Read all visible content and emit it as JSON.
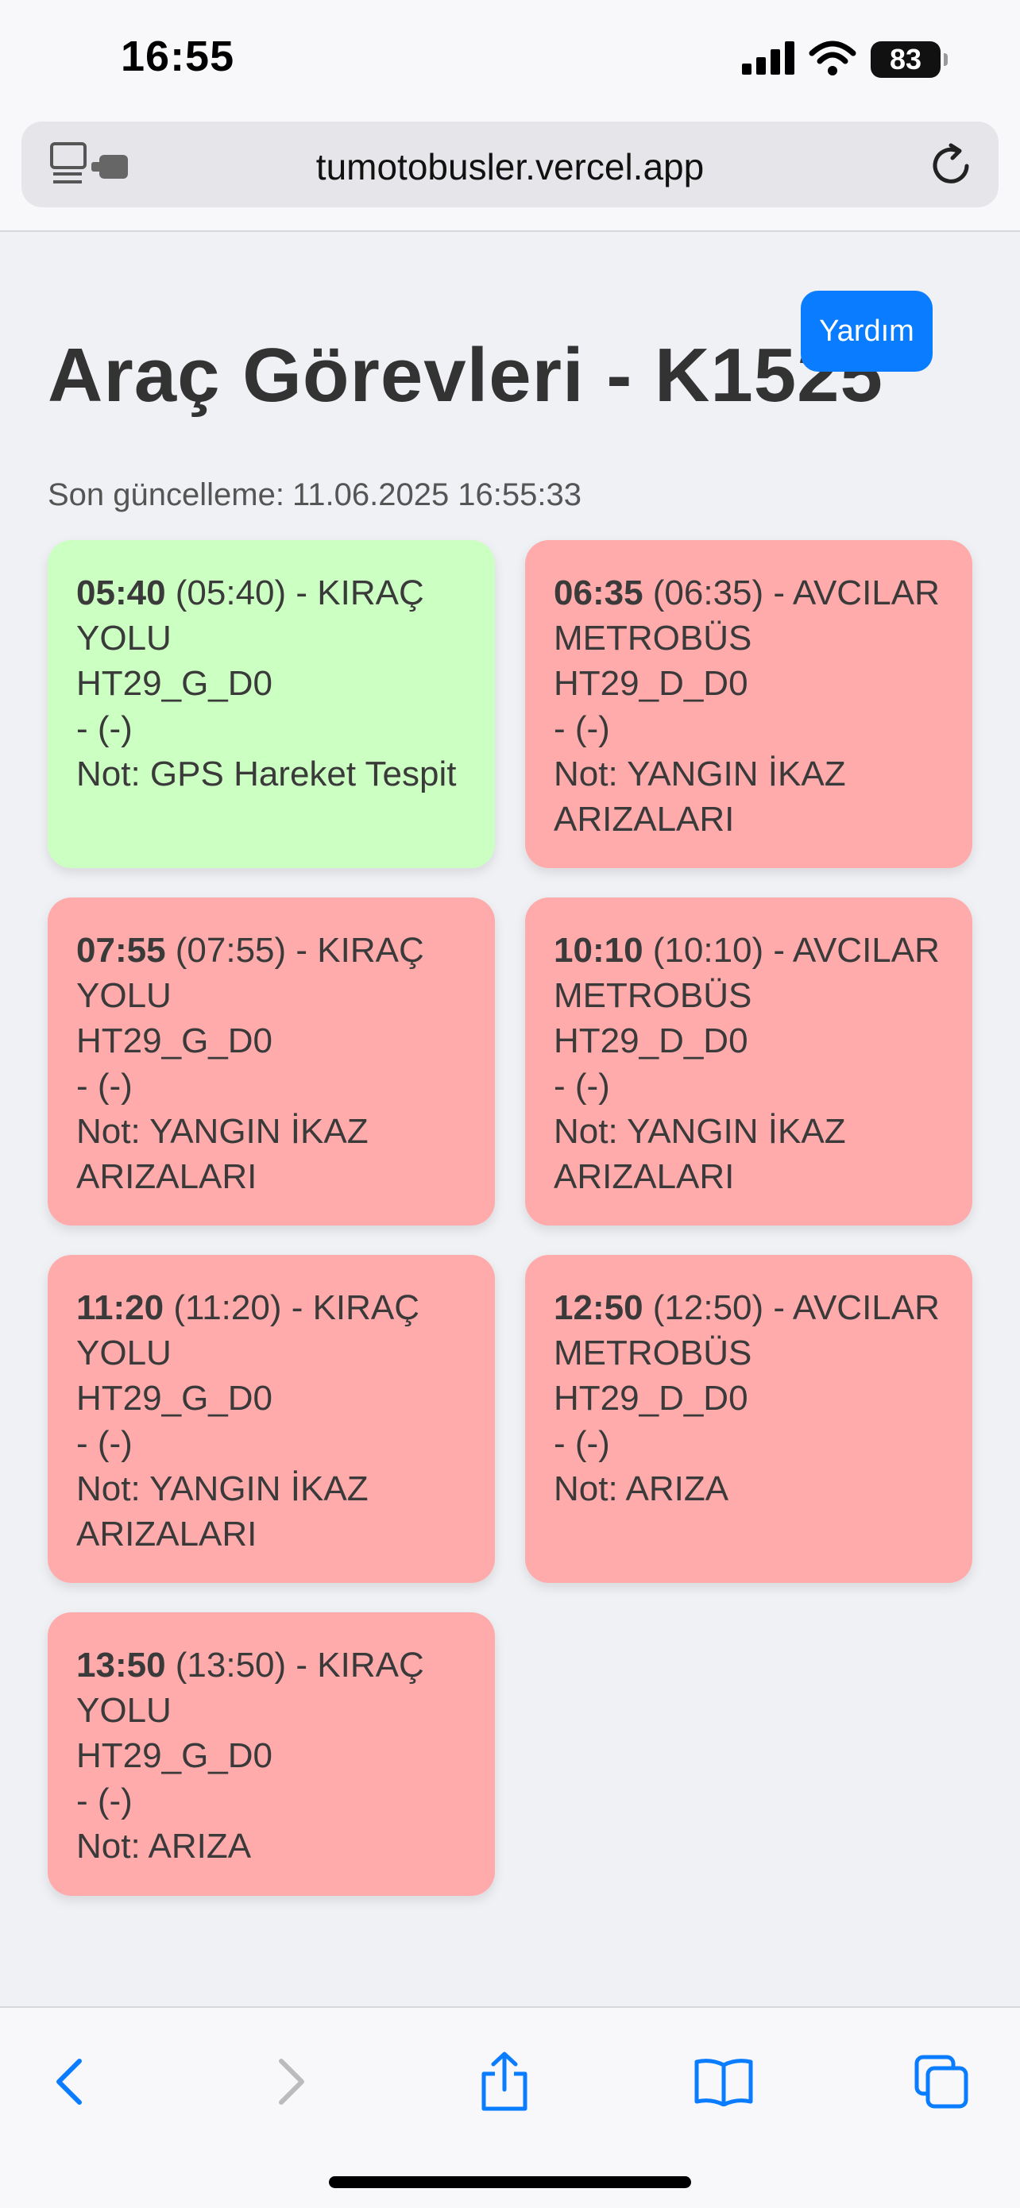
{
  "status_bar": {
    "time": "16:55",
    "battery": "83"
  },
  "browser": {
    "url": "tumotobusler.vercel.app"
  },
  "header": {
    "help_label": "Yardım",
    "title": "Araç Görevleri - K1525",
    "updated_label": "Son güncelleme:",
    "updated_value": "11.06.2025 16:55:33"
  },
  "cards": [
    {
      "time": "05:40",
      "rest_1": " (05:40) - KIRAÇ YOLU",
      "code": "HT29_G_D0",
      "extra": "- (-)",
      "note": "Not: GPS Hareket Tespit",
      "color": "#ccffc2"
    },
    {
      "time": "06:35",
      "rest_1": " (06:35) - AVCILAR METROBÜS",
      "code": "HT29_D_D0",
      "extra": "- (-)",
      "note": "Not: YANGIN İKAZ ARIZALARI",
      "color": "#ffabab"
    },
    {
      "time": "07:55",
      "rest_1": " (07:55) - KIRAÇ YOLU",
      "code": "HT29_G_D0",
      "extra": "- (-)",
      "note": "Not: YANGIN İKAZ ARIZALARI",
      "color": "#ffabab"
    },
    {
      "time": "10:10",
      "rest_1": " (10:10) - AVCILAR METROBÜS",
      "code": "HT29_D_D0",
      "extra": "- (-)",
      "note": "Not: YANGIN İKAZ ARIZALARI",
      "color": "#ffabab"
    },
    {
      "time": "11:20",
      "rest_1": " (11:20) - KIRAÇ YOLU",
      "code": "HT29_G_D0",
      "extra": "- (-)",
      "note": "Not: YANGIN İKAZ ARIZALARI",
      "color": "#ffabab"
    },
    {
      "time": "12:50",
      "rest_1": " (12:50) - AVCILAR METROBÜS",
      "code": "HT29_D_D0",
      "extra": "- (-)",
      "note": "Not: ARIZA",
      "color": "#ffabab"
    },
    {
      "time": "13:50",
      "rest_1": " (13:50) - KIRAÇ YOLU",
      "code": "HT29_G_D0",
      "extra": "- (-)",
      "note": "Not: ARIZA",
      "color": "#ffabab"
    }
  ],
  "icons": {
    "tabs": "tabs-icon",
    "reload": "reload-icon",
    "back": "back-icon",
    "forward": "forward-icon",
    "share": "share-icon",
    "bookmarks": "bookmarks-icon",
    "tab_switcher": "tab-switcher-icon"
  },
  "colors": {
    "accent": "#0a7cff",
    "ok": "#ccffc2",
    "fault": "#ffabab"
  }
}
